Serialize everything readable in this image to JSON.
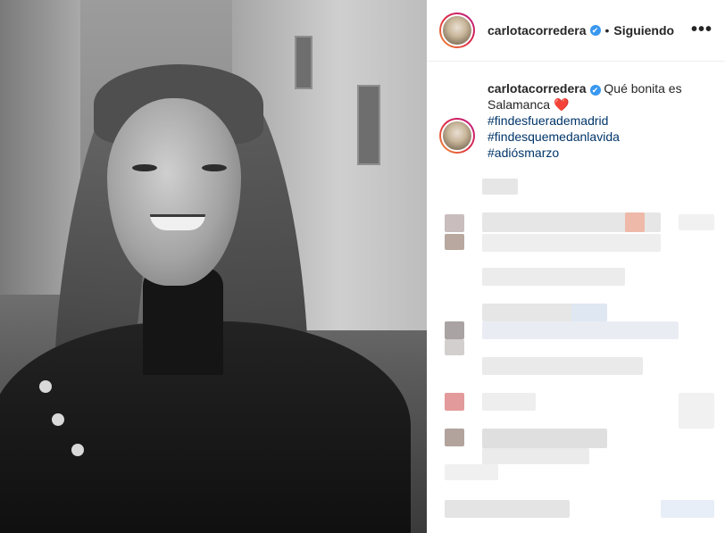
{
  "post": {
    "username": "carlotacorredera",
    "verified_mark": "✔",
    "separator": "•",
    "follow_status": "Siguiendo",
    "more_icon": "•••"
  },
  "caption": {
    "username": "carlotacorredera",
    "verified_mark": "✔",
    "text": "Qué bonita es Salamanca",
    "heart": "❤️",
    "hashtags": [
      "#findesfuerademadrid",
      "#findesquemedanlavida",
      "#adiósmarzo"
    ]
  },
  "colors": {
    "hashtag": "#003569",
    "verified": "#3897f0",
    "story_ring_start": "#f09433",
    "story_ring_end": "#bc1888"
  }
}
